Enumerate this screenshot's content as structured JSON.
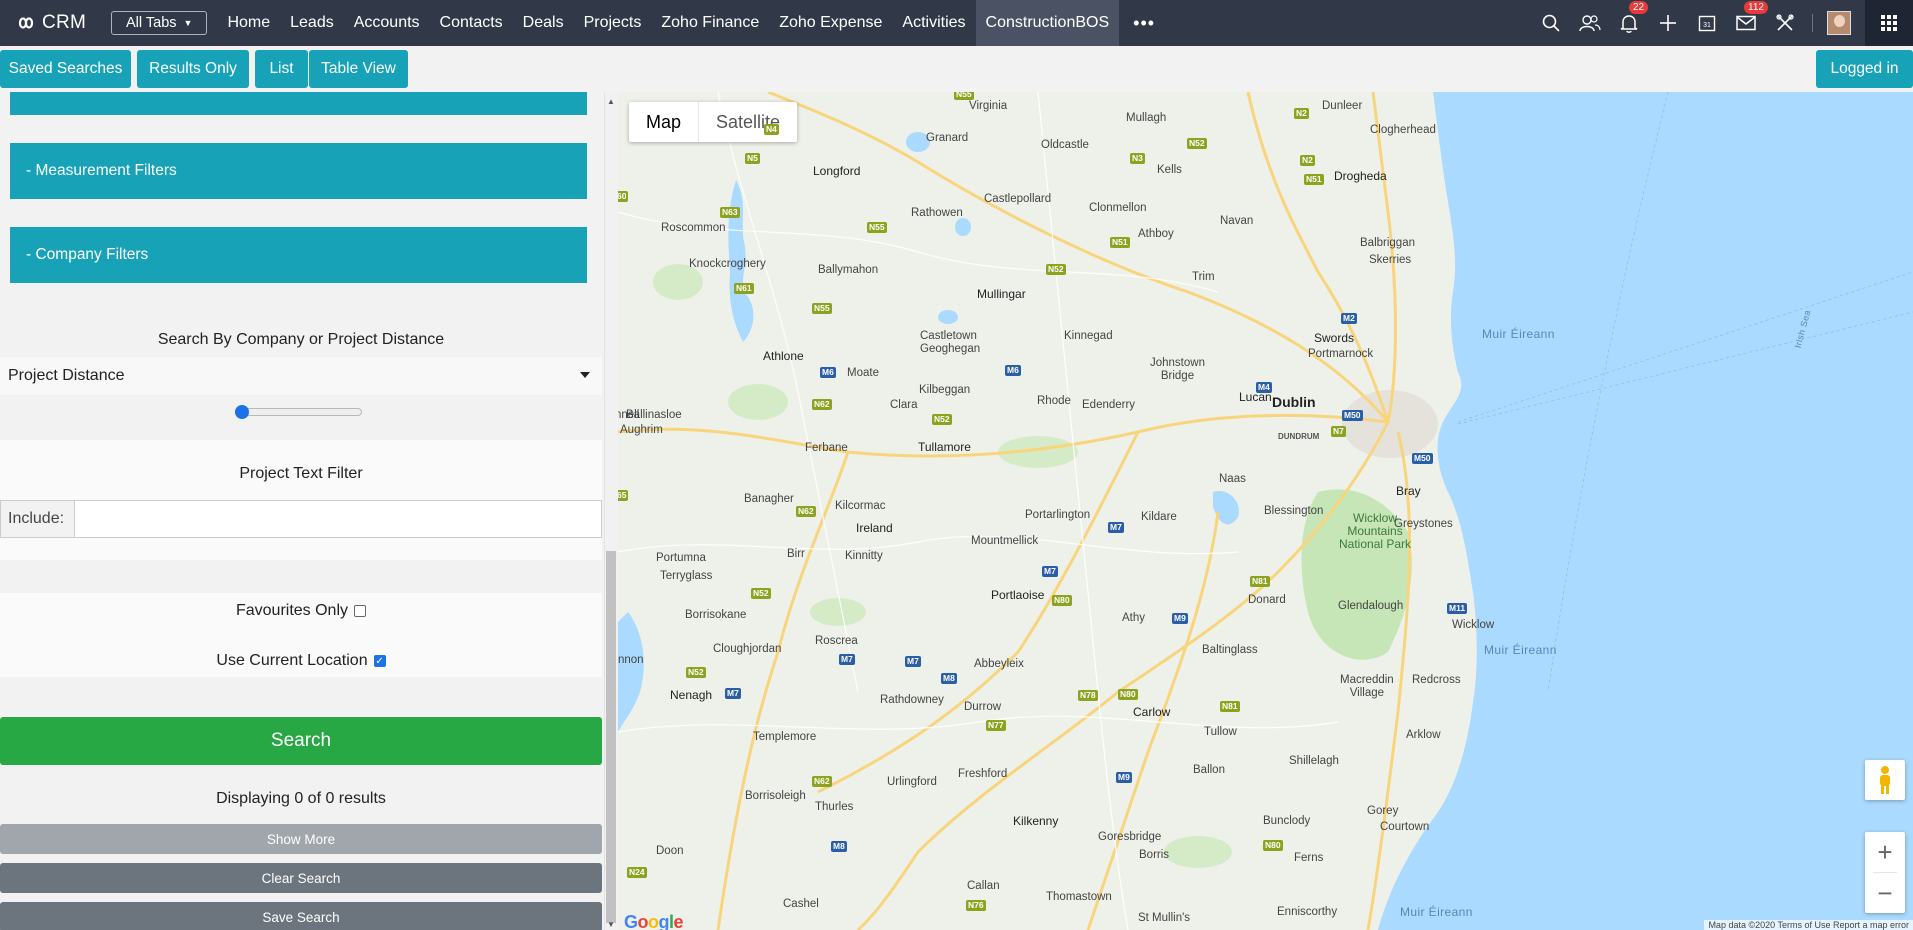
{
  "app": {
    "logo_text": "CRM"
  },
  "nav": {
    "all_tabs": "All Tabs",
    "tabs": [
      "Home",
      "Leads",
      "Accounts",
      "Contacts",
      "Deals",
      "Projects",
      "Zoho Finance",
      "Zoho Expense",
      "Activities",
      "ConstructionBOS"
    ],
    "active_tab": "ConstructionBOS",
    "more": "•••",
    "notifications_badge": "22",
    "mail_badge": "112",
    "calendar_day": "31"
  },
  "toolbar": {
    "saved_searches": "Saved Searches",
    "results_only": "Results Only",
    "list": "List",
    "table_view": "Table View",
    "logged_in": "Logged in"
  },
  "filters": {
    "measurement": "- Measurement Filters",
    "company": "- Company Filters",
    "distance_heading": "Search By Company or Project Distance",
    "distance_select": "Project Distance",
    "distance_slider_value": 0,
    "text_filter_heading": "Project Text Filter",
    "include_label": "Include:",
    "include_value": "",
    "favourites_label": "Favourites Only",
    "favourites_checked": false,
    "location_label": "Use Current Location",
    "location_checked": true
  },
  "actions": {
    "search": "Search",
    "results_text": "Displaying 0 of 0 results",
    "show_more": "Show More",
    "clear_search": "Clear Search",
    "save_search": "Save Search"
  },
  "map": {
    "type_map": "Map",
    "type_satellite": "Satellite",
    "places": {
      "virginia": "Virginia",
      "mullagh": "Mullagh",
      "dunleer": "Dunleer",
      "clogherhead": "Clogherhead",
      "granard": "Granard",
      "oldcastle": "Oldcastle",
      "kells": "Kells",
      "drogheda": "Drogheda",
      "longford": "Longford",
      "castlepollard": "Castlepollard",
      "clonmellon": "Clonmellon",
      "navan": "Navan",
      "roscommon": "Roscommon",
      "rathowen": "Rathowen",
      "athboy": "Athboy",
      "balbriggan": "Balbriggan",
      "skerries": "Skerries",
      "knockcroghery": "Knockcroghery",
      "ballymahon": "Ballymahon",
      "trim": "Trim",
      "mullingar": "Mullingar",
      "athlone": "Athlone",
      "castletown_geoghegan": "Castletown\nGeoghegan",
      "kinnegad": "Kinnegad",
      "johnstown_bridge": "Johnstown\nBridge",
      "swords": "Swords",
      "portmarnock": "Portmarnock",
      "moate": "Moate",
      "kilbeggan": "Kilbeggan",
      "rhode": "Rhode",
      "edenderry": "Edenderry",
      "lucan": "Lucan",
      "dublin": "Dublin",
      "dundrum": "DUNDRUM",
      "ballinasloe": "Ballinasloe",
      "aughrim": "Aughrim",
      "clara": "Clara",
      "tullamore": "Tullamore",
      "ferbane": "Ferbane",
      "naas": "Naas",
      "bray": "Bray",
      "greystones": "Greystones",
      "blessington": "Blessington",
      "banagher": "Banagher",
      "kilcormac": "Kilcormac",
      "portarlington": "Portarlington",
      "kildare": "Kildare",
      "ireland": "Ireland",
      "mountmellick": "Mountmellick",
      "birr": "Birr",
      "kinnitty": "Kinnitty",
      "portumna": "Portumna",
      "terryglass": "Terryglass",
      "portlaoise": "Portlaoise",
      "athy": "Athy",
      "donard": "Donard",
      "glendalough": "Glendalough",
      "wicklow": "Wicklow",
      "borrisokane": "Borrisokane",
      "baltinglass": "Baltinglass",
      "cloughjordan": "Cloughjordan",
      "roscrea": "Roscrea",
      "abbeyleix": "Abbeyleix",
      "macreddin_village": "Macreddin\nVillage",
      "redcross": "Redcross",
      "nenagh": "Nenagh",
      "rathdowney": "Rathdowney",
      "durrow": "Durrow",
      "carlow": "Carlow",
      "tullow": "Tullow",
      "arklow": "Arklow",
      "templemore": "Templemore",
      "borrisoleigh": "Borrisoleigh",
      "urlingford": "Urlingford",
      "freshford": "Freshford",
      "ballon": "Ballon",
      "shillelagh": "Shillelagh",
      "thurles": "Thurles",
      "kilkenny": "Kilkenny",
      "gorey": "Gorey",
      "bunclody": "Bunclody",
      "goresbridge": "Goresbridge",
      "borris": "Borris",
      "courtown": "Courtown",
      "doon": "Doon",
      "callan": "Callan",
      "ferns": "Ferns",
      "thomastown": "Thomastown",
      "cashel": "Cashel",
      "st_mullins": "St Mullin's",
      "enniscorthy": "Enniscorthy",
      "muir_eireann_1": "Muir Éireann",
      "muir_eireann_2": "Muir Éireann",
      "muir_eireann_3": "Muir Éireann",
      "irish_sea": "Irish Sea",
      "wicklow_park": "Wicklow\nMountains\nNational Park",
      "nnell": "nnell",
      "nnon": "nnon"
    },
    "google_logo": "Google",
    "attribution": "Map data ©2020   Terms of Use   Report a map error",
    "colors": {
      "sea": "#aadaff",
      "land": "#eef1ea",
      "park": "#c7e6b7",
      "road": "#f8d57d",
      "motorway_shield": "#2a5ea8",
      "national_shield": "#8ca320"
    }
  }
}
